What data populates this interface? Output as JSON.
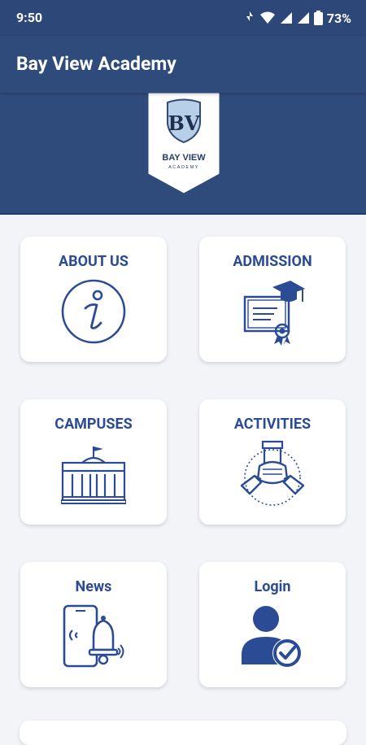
{
  "status_bar": {
    "time": "9:50",
    "battery": "73%",
    "icons": [
      "nfc-icon",
      "wifi-icon",
      "signal-icon",
      "signal-icon",
      "battery-icon"
    ]
  },
  "app_bar": {
    "title": "Bay View Academy"
  },
  "logo": {
    "name": "BAY VIEW",
    "subtitle": "ACADEMY",
    "monogram": "BV"
  },
  "tiles": [
    {
      "label": "ABOUT US",
      "icon": "info-icon"
    },
    {
      "label": "ADMISSION",
      "icon": "diploma-icon"
    },
    {
      "label": "CAMPUSES",
      "icon": "building-icon"
    },
    {
      "label": "ACTIVITIES",
      "icon": "teamwork-hands-icon"
    },
    {
      "label": "News",
      "icon": "phone-bell-icon"
    },
    {
      "label": "Login",
      "icon": "user-check-icon"
    }
  ],
  "colors": {
    "header": "#2f4b7c",
    "status_bar": "#2c4778",
    "tile_text": "#2b4c95",
    "background": "#f3f4f8"
  }
}
